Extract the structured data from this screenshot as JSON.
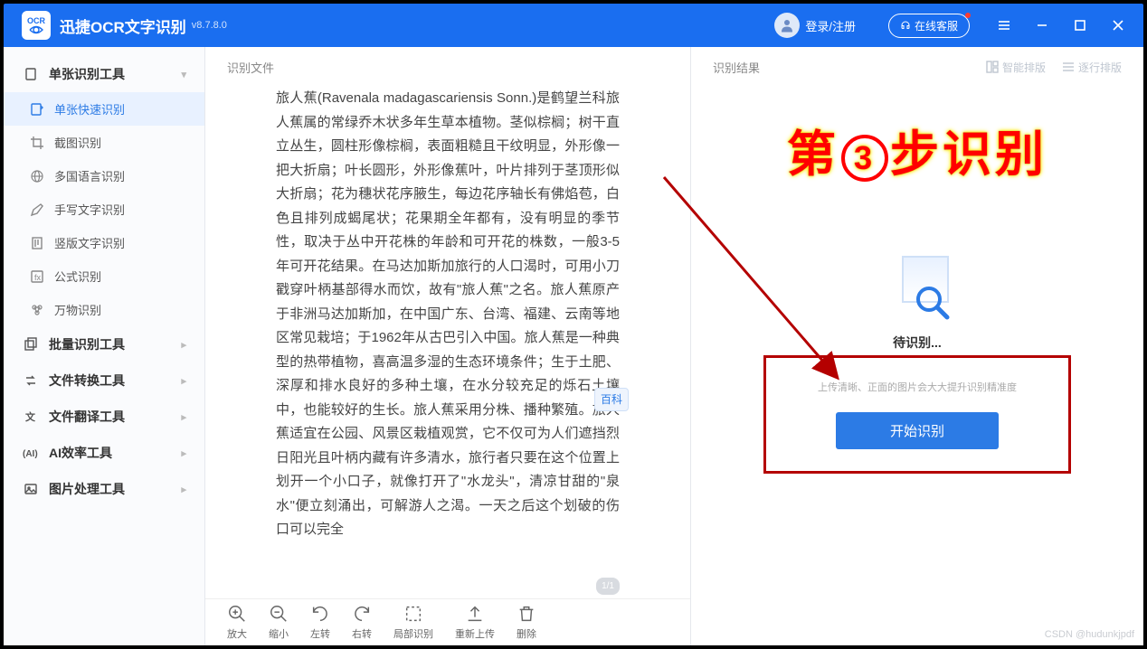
{
  "app": {
    "title": "迅捷OCR文字识别",
    "version": "v8.7.8.0"
  },
  "header": {
    "login": "登录/注册",
    "service": "在线客服"
  },
  "sidebar": {
    "groups": [
      {
        "label": "单张识别工具",
        "open": true,
        "items": [
          {
            "label": "单张快速识别"
          },
          {
            "label": "截图识别"
          },
          {
            "label": "多国语言识别"
          },
          {
            "label": "手写文字识别"
          },
          {
            "label": "竖版文字识别"
          },
          {
            "label": "公式识别"
          },
          {
            "label": "万物识别"
          }
        ]
      },
      {
        "label": "批量识别工具"
      },
      {
        "label": "文件转换工具"
      },
      {
        "label": "文件翻译工具"
      },
      {
        "label": "AI效率工具"
      },
      {
        "label": "图片处理工具"
      }
    ]
  },
  "left": {
    "header": "识别文件",
    "page": "1/1",
    "text": "旅人蕉(Ravenala madagascariensis Sonn.)是鹤望兰科旅人蕉属的常绿乔木状多年生草本植物。茎似棕榈；树干直立丛生，圆柱形像棕榈，表面粗糙且干纹明显，外形像一把大折扇；叶长圆形，外形像蕉叶，叶片排列于茎顶形似大折扇；花为穗状花序腋生，每边花序轴长有佛焰苞，白色且排列成蝎尾状；花果期全年都有，没有明显的季节性，取决于丛中开花株的年龄和可开花的株数，一般3-5年可开花结果。在马达加斯加旅行的人口渴时，可用小刀戳穿叶柄基部得水而饮，故有\"旅人蕉\"之名。旅人蕉原产于非洲马达加斯加，在中国广东、台湾、福建、云南等地区常见栽培；于1962年从古巴引入中国。旅人蕉是一种典型的热带植物，喜高温多湿的生态环境条件；生于土肥、深厚和排水良好的多种土壤，在水分较充足的烁石土壤中，也能较好的生长。旅人蕉采用分株、播种繁殖。旅人蕉适宜在公园、风景区栽植观赏，它不仅可为人们遮挡烈日阳光且叶柄内藏有许多清水，旅行者只要在这个位置上划开一个小口子，就像打开了\"水龙头\"，清凉甘甜的\"泉水\"便立刻涌出，可解游人之渴。一天之后这个划破的伤口可以完全",
    "baike": "百科"
  },
  "tools": [
    {
      "label": "放大"
    },
    {
      "label": "缩小"
    },
    {
      "label": "左转"
    },
    {
      "label": "右转"
    },
    {
      "label": "局部识别"
    },
    {
      "label": "重新上传"
    },
    {
      "label": "删除"
    }
  ],
  "right": {
    "header": "识别结果",
    "smart": "智能排版",
    "linebyline": "逐行排版",
    "step": "第③步识别",
    "wait": "待识别...",
    "hint": "上传清晰、正面的图片会大大提升识别精准度",
    "start": "开始识别"
  },
  "watermark": "CSDN @hudunkjpdf"
}
